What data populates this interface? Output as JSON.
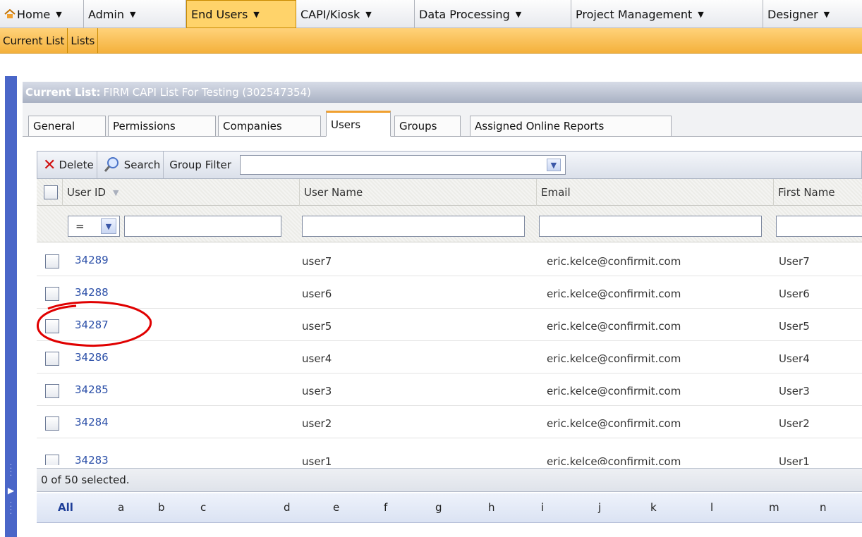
{
  "menubar": {
    "items": [
      {
        "label": "Home"
      },
      {
        "label": "Admin"
      },
      {
        "label": "End Users"
      },
      {
        "label": "CAPI/Kiosk"
      },
      {
        "label": "Data Processing"
      },
      {
        "label": "Project Management"
      },
      {
        "label": "Designer"
      }
    ],
    "active_color": "#ffd36a"
  },
  "submenu": {
    "items": [
      {
        "label": "Current List"
      },
      {
        "label": "Lists"
      }
    ]
  },
  "panel": {
    "prefix": "Current List:",
    "title": "FIRM CAPI List For Testing (302547354)"
  },
  "tabs": [
    {
      "label": "General"
    },
    {
      "label": "Permissions"
    },
    {
      "label": "Companies"
    },
    {
      "label": "Users"
    },
    {
      "label": "Groups"
    },
    {
      "label": "Assigned Online Reports"
    }
  ],
  "toolbar": {
    "delete_label": "Delete",
    "search_label": "Search",
    "group_filter_label": "Group Filter",
    "group_filter_value": ""
  },
  "grid": {
    "columns": [
      "User ID",
      "User Name",
      "Email",
      "First Name"
    ],
    "id_filter_operator": "=",
    "rows": [
      {
        "id": "34289",
        "name": "user7",
        "email": "eric.kelce@confirmit.com",
        "first": "User7"
      },
      {
        "id": "34288",
        "name": "user6",
        "email": "eric.kelce@confirmit.com",
        "first": "User6"
      },
      {
        "id": "34287",
        "name": "user5",
        "email": "eric.kelce@confirmit.com",
        "first": "User5"
      },
      {
        "id": "34286",
        "name": "user4",
        "email": "eric.kelce@confirmit.com",
        "first": "User4"
      },
      {
        "id": "34285",
        "name": "user3",
        "email": "eric.kelce@confirmit.com",
        "first": "User3"
      },
      {
        "id": "34284",
        "name": "user2",
        "email": "eric.kelce@confirmit.com",
        "first": "User2"
      },
      {
        "id": "34283",
        "name": "user1",
        "email": "eric.kelce@confirmit.com",
        "first": "User1"
      }
    ],
    "highlighted_row_id": "34287"
  },
  "status": {
    "text": "0 of 50 selected."
  },
  "alphabet": [
    "All",
    "a",
    "b",
    "c",
    "d",
    "e",
    "f",
    "g",
    "h",
    "i",
    "j",
    "k",
    "l",
    "m",
    "n"
  ],
  "colors": {
    "link": "#2b4fa8",
    "annotation": "#e00000",
    "rail": "#4a66c8"
  }
}
